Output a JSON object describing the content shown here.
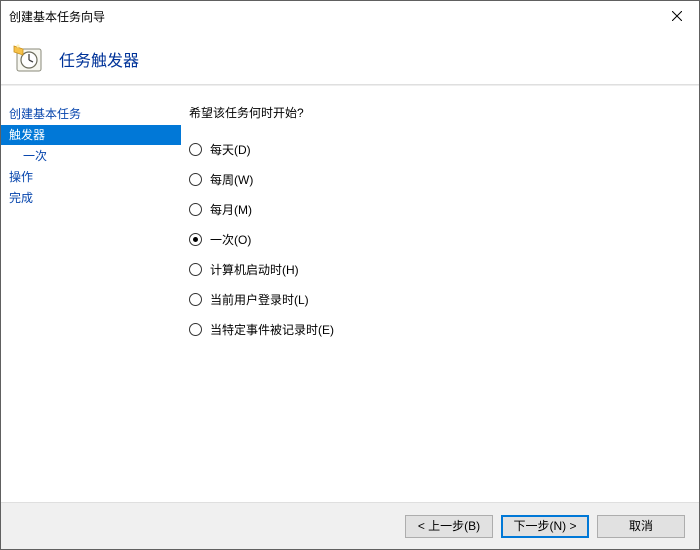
{
  "window": {
    "title": "创建基本任务向导"
  },
  "header": {
    "title": "任务触发器"
  },
  "nav": {
    "items": [
      {
        "label": "创建基本任务",
        "indent": false,
        "selected": false
      },
      {
        "label": "触发器",
        "indent": false,
        "selected": true
      },
      {
        "label": "一次",
        "indent": true,
        "selected": false
      },
      {
        "label": "操作",
        "indent": false,
        "selected": false
      },
      {
        "label": "完成",
        "indent": false,
        "selected": false
      }
    ]
  },
  "content": {
    "prompt": "希望该任务何时开始?",
    "options": [
      {
        "label": "每天(D)",
        "checked": false
      },
      {
        "label": "每周(W)",
        "checked": false
      },
      {
        "label": "每月(M)",
        "checked": false
      },
      {
        "label": "一次(O)",
        "checked": true
      },
      {
        "label": "计算机启动时(H)",
        "checked": false
      },
      {
        "label": "当前用户登录时(L)",
        "checked": false
      },
      {
        "label": "当特定事件被记录时(E)",
        "checked": false
      }
    ]
  },
  "buttons": {
    "back": "< 上一步(B)",
    "next": "下一步(N) >",
    "cancel": "取消"
  }
}
